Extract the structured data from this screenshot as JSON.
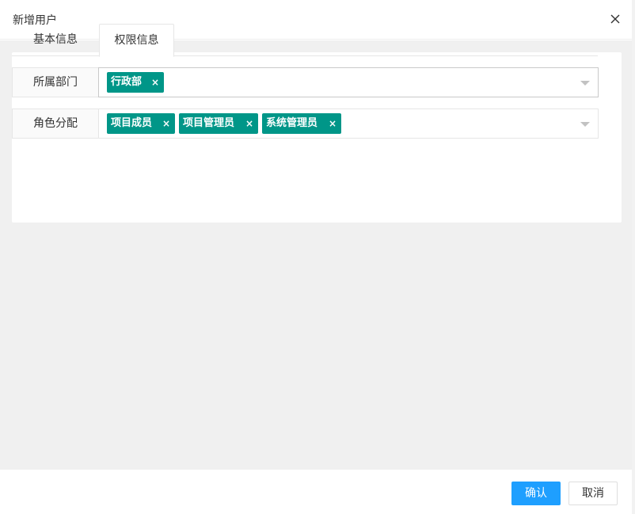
{
  "dialog": {
    "title": "新增用户",
    "close_icon": "close-icon"
  },
  "tabs": [
    {
      "label": "基本信息",
      "active": false
    },
    {
      "label": "权限信息",
      "active": true
    }
  ],
  "form": {
    "department": {
      "label": "所属部门",
      "tags": [
        "行政部"
      ]
    },
    "roles": {
      "label": "角色分配",
      "tags": [
        "项目成员",
        "项目管理员",
        "系统管理员"
      ]
    },
    "tag_remove_glyph": "×",
    "dropdown_icon": "caret-down-icon"
  },
  "footer": {
    "confirm_label": "确认",
    "cancel_label": "取消"
  },
  "colors": {
    "tag": "#009688",
    "primary_button": "#1e9fff",
    "body_background": "#f0f0f0"
  }
}
